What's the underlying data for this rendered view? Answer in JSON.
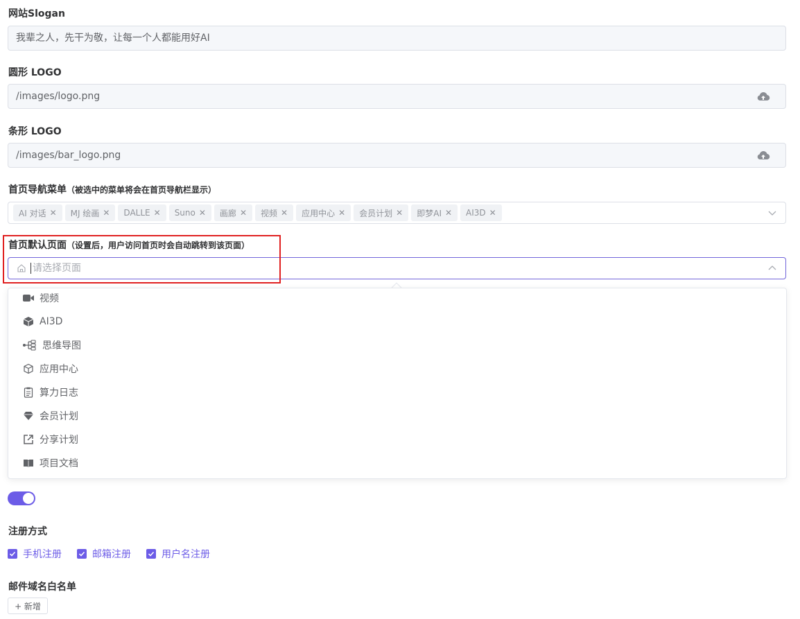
{
  "fields": {
    "slogan": {
      "label": "网站Slogan",
      "value": "我辈之人，先干为敬，让每一个人都能用好AI"
    },
    "round_logo": {
      "label": "圆形 LOGO",
      "value": "/images/logo.png"
    },
    "bar_logo": {
      "label": "条形 LOGO",
      "value": "/images/bar_logo.png"
    },
    "nav_menu": {
      "label": "首页导航菜单",
      "hint": "（被选中的菜单将会在首页导航栏显示）",
      "tags": [
        "AI 对话",
        "MJ 绘画",
        "DALLE",
        "Suno",
        "画廊",
        "视频",
        "应用中心",
        "会员计划",
        "即梦AI",
        "AI3D"
      ]
    },
    "default_page": {
      "label": "首页默认页面",
      "hint": "（设置后，用户访问首页时会自动跳转到该页面）",
      "placeholder": "请选择页面",
      "options": [
        {
          "label": "视频",
          "icon": "video-icon"
        },
        {
          "label": "AI3D",
          "icon": "cube-icon"
        },
        {
          "label": "思维导图",
          "icon": "mindmap-icon"
        },
        {
          "label": "应用中心",
          "icon": "box-icon"
        },
        {
          "label": "算力日志",
          "icon": "clipboard-icon"
        },
        {
          "label": "会员计划",
          "icon": "diamond-icon"
        },
        {
          "label": "分享计划",
          "icon": "share-icon"
        },
        {
          "label": "项目文档",
          "icon": "book-icon"
        }
      ]
    },
    "register": {
      "label": "注册方式",
      "methods": [
        "手机注册",
        "邮箱注册",
        "用户名注册"
      ]
    },
    "email_whitelist": {
      "label": "邮件域名白名单",
      "add_label": "+ 新增"
    }
  },
  "colors": {
    "accent": "#6c5ce7",
    "highlight": "#e02020"
  }
}
